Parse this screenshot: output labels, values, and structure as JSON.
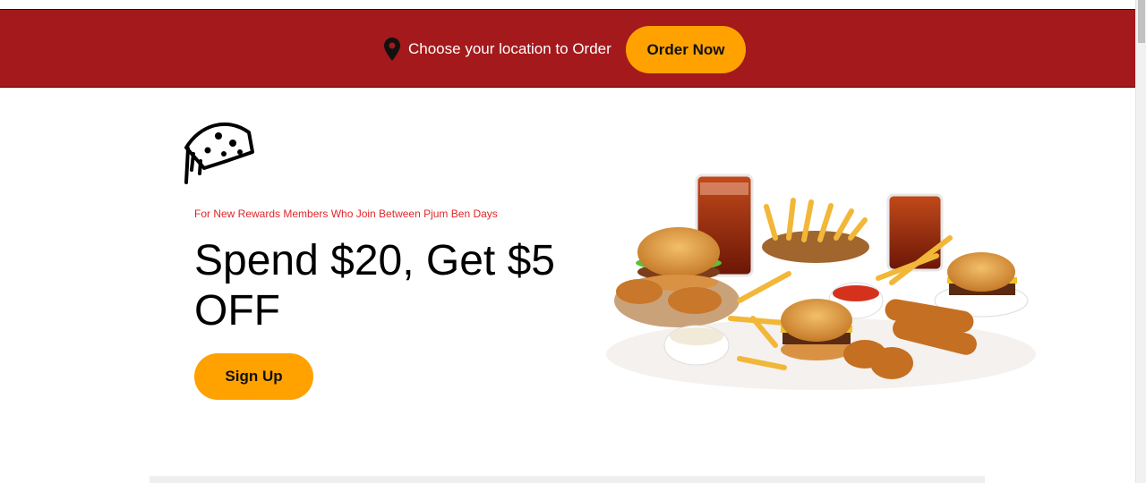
{
  "banner": {
    "location_text": "Choose your location to Order",
    "order_label": "Order Now",
    "icon": "location-pin-icon",
    "background_color": "#a4191c"
  },
  "brand": {
    "logo_icon": "pizza-slice-icon"
  },
  "promo": {
    "kicker": "For New Rewards Members Who Join Between Pjum Ben Days",
    "title": "Spend $20, Get $5 OFF",
    "signup_label": "Sign Up",
    "accent_color": "#ffa200",
    "kicker_color": "#e0262a"
  },
  "hero": {
    "image": "fast-food-spread-illustration"
  }
}
